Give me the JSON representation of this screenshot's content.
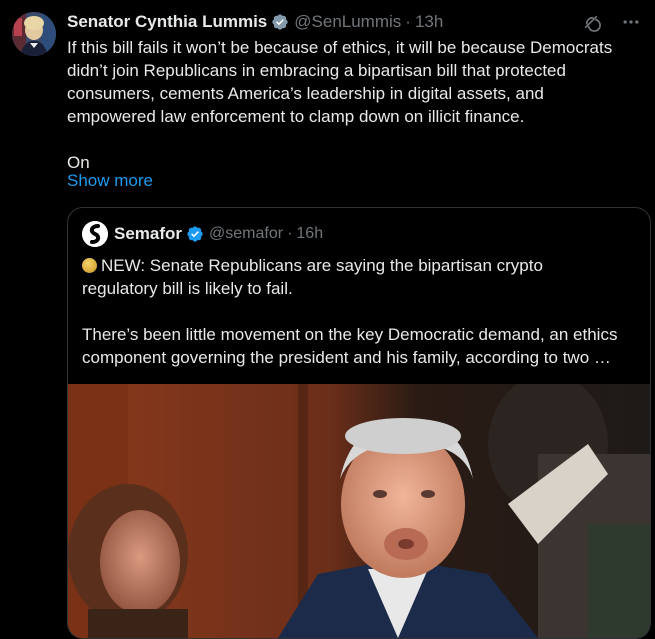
{
  "tweet": {
    "author_name": "Senator Cynthia Lummis",
    "handle": "@SenLummis",
    "separator": "·",
    "time": "13h",
    "text": "If this bill fails it won’t be because of ethics, it will be because Democrats\ndidn’t join Republicans in embracing a bipartisan bill that protected\nconsumers, cements America’s leadership in digital assets, and\nempowered law enforcement to clamp down on illicit finance.\n\nOn",
    "show_more_label": "Show more",
    "icons": {
      "verified": "verified-badge-icon",
      "grok": "grok-icon",
      "more": "more-options-icon"
    }
  },
  "quote": {
    "author_name": "Semafor",
    "handle": "@semafor",
    "separator": "·",
    "time": "16h",
    "text": "NEW: Senate Republicans are saying the bipartisan crypto\nregulatory bill is likely to fail.\n\nThere’s been little movement on the key Democratic demand, an ethics\ncomponent governing the president and his family, according to two …"
  },
  "colors": {
    "background": "#000000",
    "text": "#e7e9ea",
    "muted": "#71767b",
    "link": "#1d9bf0",
    "verified": "#1d9bf0",
    "border": "#2f3336"
  }
}
